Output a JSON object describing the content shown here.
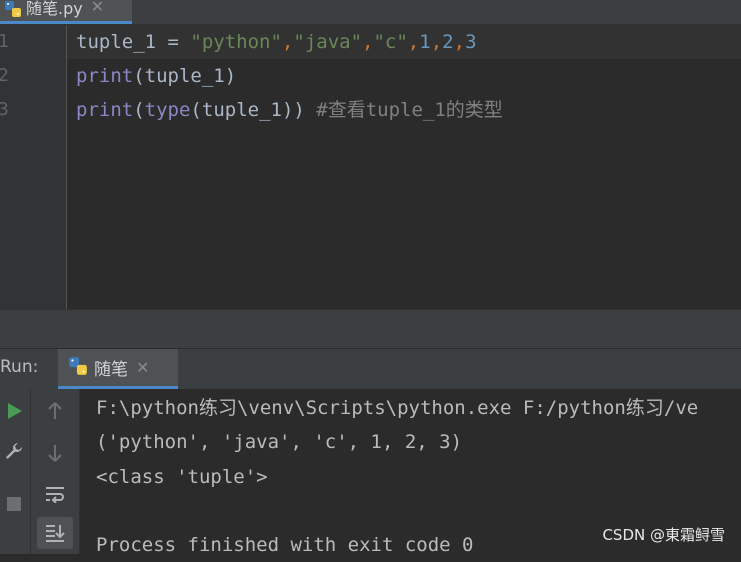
{
  "editor_tab": {
    "filename": "随笔.py",
    "close": "✕"
  },
  "editor": {
    "line_numbers": [
      "1",
      "2",
      "3"
    ],
    "line1": {
      "var": "tuple_1",
      "eq": " = ",
      "s1": "\"python\"",
      "s2": "\"java\"",
      "s3": "\"c\"",
      "n1": "1",
      "n2": "2",
      "n3": "3",
      "comma": ","
    },
    "line2": {
      "fn": "print",
      "open": "(",
      "arg": "tuple_1",
      "close": ")"
    },
    "line3": {
      "fn": "print",
      "open": "(",
      "fn2": "type",
      "open2": "(",
      "arg": "tuple_1",
      "close": "))",
      "comment": " #查看tuple_1的类型"
    }
  },
  "run_panel": {
    "label": "Run:",
    "tab_name": "随笔",
    "close": "✕",
    "console_lines": [
      "F:\\python练习\\venv\\Scripts\\python.exe F:/python练习/ve",
      "('python', 'java', 'c', 1, 2, 3)",
      "<class 'tuple'>",
      "",
      "Process finished with exit code 0"
    ]
  },
  "watermark": "CSDN @東霜鲟雪",
  "colors": {
    "accent": "#4a88c7",
    "run_green": "#499c54",
    "keyword": "#8888c6",
    "string": "#6a8759",
    "number": "#6897bb"
  }
}
